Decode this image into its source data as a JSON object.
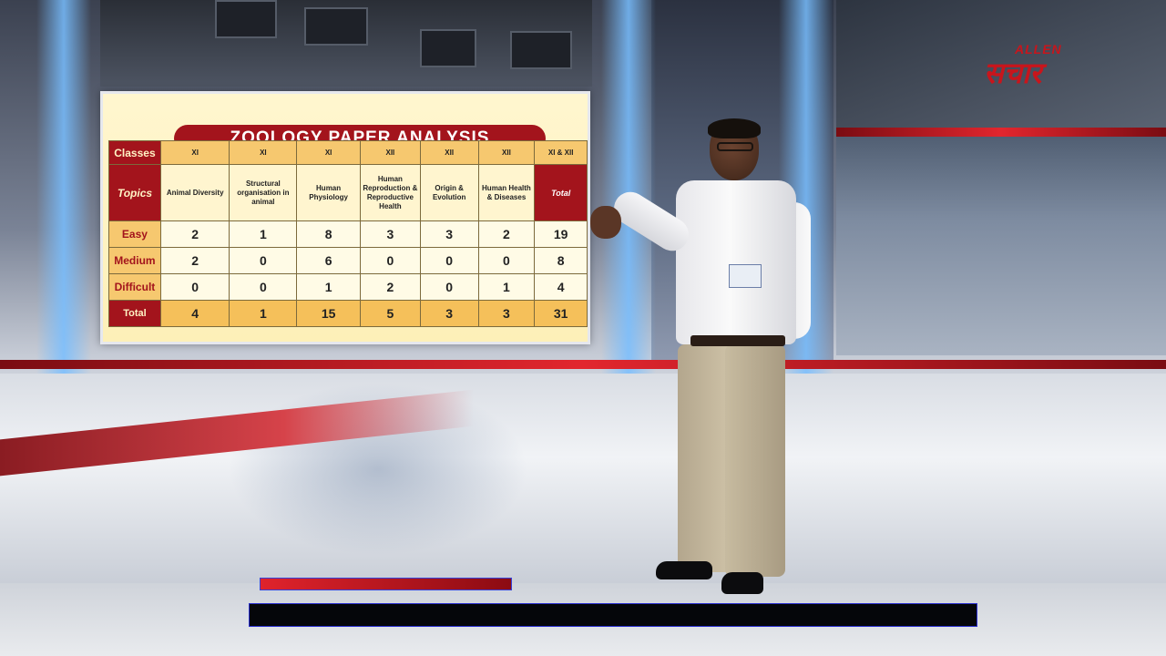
{
  "board": {
    "title": "ZOOLOGY PAPER ANALYSIS",
    "row_headers": {
      "classes": "Classes",
      "topics": "Topics"
    },
    "columns": [
      {
        "class": "XI",
        "topic": "Animal Diversity"
      },
      {
        "class": "XI",
        "topic": "Structural organisation in animal"
      },
      {
        "class": "XI",
        "topic": "Human Physiology"
      },
      {
        "class": "XII",
        "topic": "Human Reproduction & Reproductive Health"
      },
      {
        "class": "XII",
        "topic": "Origin & Evolution"
      },
      {
        "class": "XII",
        "topic": "Human Health & Diseases"
      },
      {
        "class": "XI & XII",
        "topic": "Total"
      }
    ],
    "rows": [
      {
        "label": "Easy",
        "values": [
          "2",
          "1",
          "8",
          "3",
          "3",
          "2",
          "19"
        ]
      },
      {
        "label": "Medium",
        "values": [
          "2",
          "0",
          "6",
          "0",
          "0",
          "0",
          "8"
        ]
      },
      {
        "label": "Difficult",
        "values": [
          "0",
          "0",
          "1",
          "2",
          "0",
          "1",
          "4"
        ]
      },
      {
        "label": "Total",
        "values": [
          "4",
          "1",
          "15",
          "5",
          "3",
          "3",
          "31"
        ]
      }
    ]
  },
  "logo": {
    "brand": "ALLEN",
    "sub": "सचार"
  },
  "colors": {
    "accent_red": "#a3141c",
    "header_gold": "#f6c86f",
    "board_bg": "#fff6cf"
  }
}
